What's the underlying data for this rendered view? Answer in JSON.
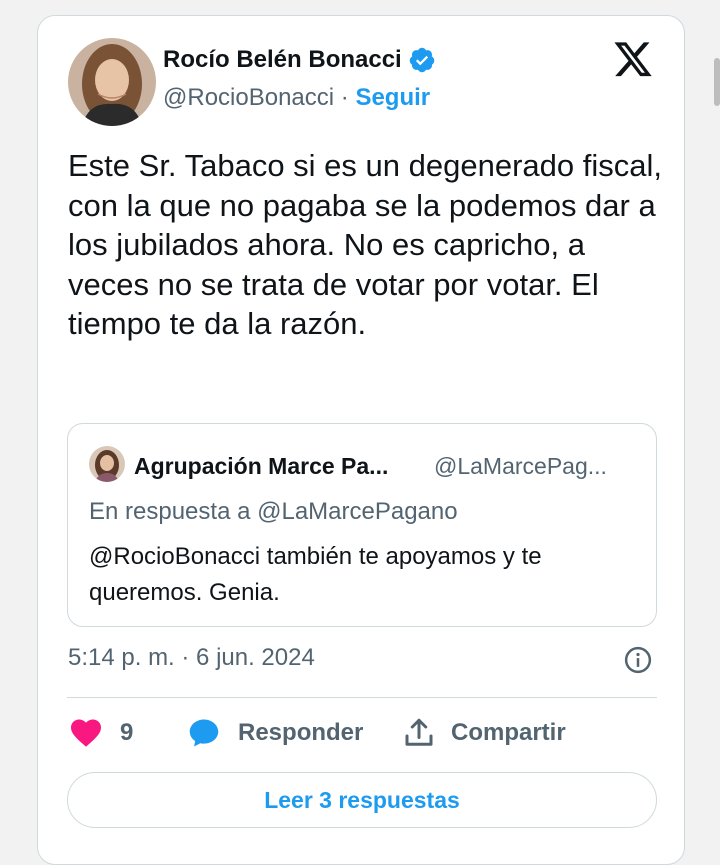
{
  "author": {
    "name": "Rocío Belén Bonacci",
    "handle": "@RocioBonacci",
    "separator": "·",
    "follow_label": "Seguir"
  },
  "icons": {
    "verified": "verified-badge-icon",
    "logo": "x-logo-icon",
    "info": "info-icon",
    "like": "heart-icon",
    "reply": "speech-bubble-icon",
    "share": "share-upload-icon"
  },
  "tweet": {
    "text": "Este Sr. Tabaco si es un degenerado fiscal, con la que no pagaba se la podemos dar a los jubilados ahora. No es capricho, a veces no se trata de votar por votar. El tiempo te da la razón."
  },
  "quoted": {
    "name": "Agrupación Marce Pa...",
    "handle": "@LaMarcePag...",
    "reply_to": "En respuesta a @LaMarcePagano",
    "text": "@RocioBonacci también te apoyamos y te queremos. Genia."
  },
  "timestamp": "5:14 p. m. · 6 jun. 2024",
  "actions": {
    "like_count": "9",
    "reply_label": "Responder",
    "share_label": "Compartir"
  },
  "read_replies_label": "Leer 3 respuestas",
  "colors": {
    "accent": "#1d9bf0",
    "like": "#f91880",
    "text": "#0f1419",
    "muted": "#536471",
    "border": "#cfd9de"
  }
}
